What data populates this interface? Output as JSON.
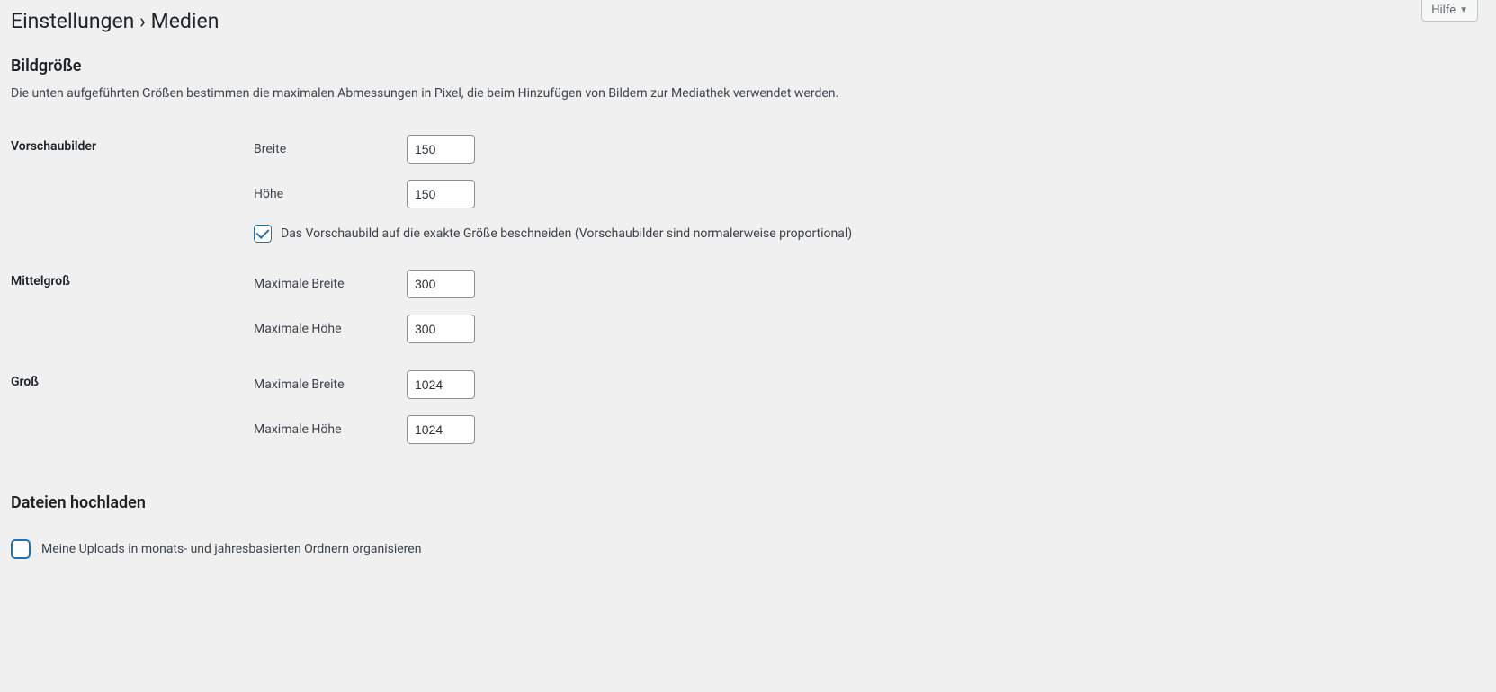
{
  "help_tab": {
    "label": "Hilfe"
  },
  "page_title": "Einstellungen › Medien",
  "section_imagesize": {
    "title": "Bildgröße",
    "description": "Die unten aufgeführten Größen bestimmen die maximalen Abmessungen in Pixel, die beim Hinzufügen von Bildern zur Mediathek verwendet werden."
  },
  "thumbnails": {
    "heading": "Vorschaubilder",
    "width_label": "Breite",
    "width_value": "150",
    "height_label": "Höhe",
    "height_value": "150",
    "crop_label": "Das Vorschaubild auf die exakte Größe beschneiden (Vorschaubilder sind normalerweise proportional)",
    "crop_checked": true
  },
  "medium": {
    "heading": "Mittelgroß",
    "width_label": "Maximale Breite",
    "width_value": "300",
    "height_label": "Maximale Höhe",
    "height_value": "300"
  },
  "large": {
    "heading": "Groß",
    "width_label": "Maximale Breite",
    "width_value": "1024",
    "height_label": "Maximale Höhe",
    "height_value": "1024"
  },
  "upload": {
    "title": "Dateien hochladen",
    "organize_label": "Meine Uploads in monats- und jahresbasierten Ordnern organisieren",
    "organize_checked": false
  }
}
